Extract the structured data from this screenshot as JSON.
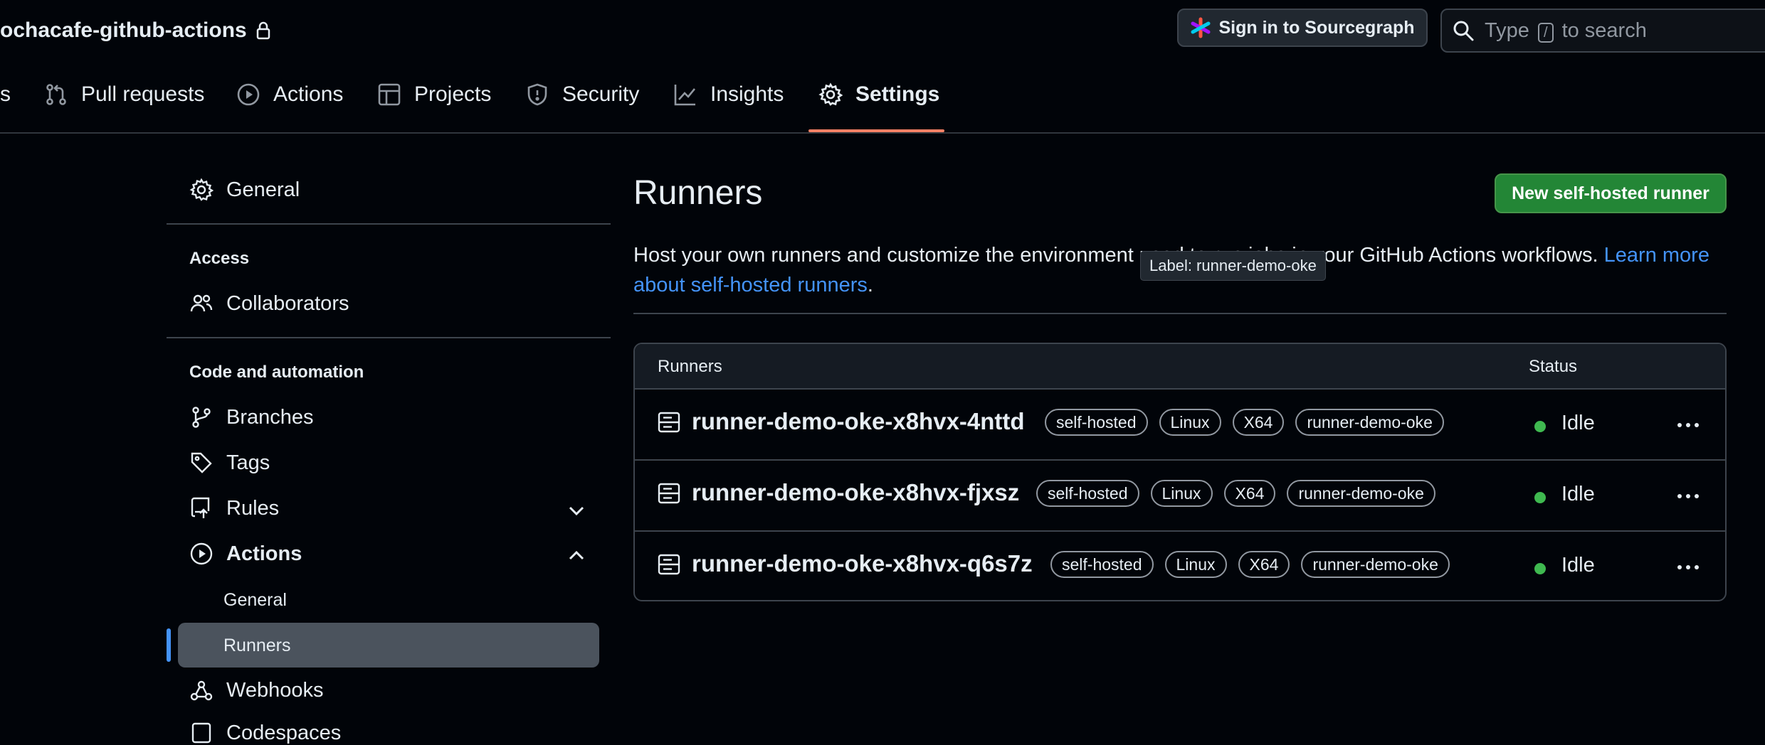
{
  "header": {
    "repo_title": "ochacafe-github-actions",
    "sourcegraph_button": "Sign in to Sourcegraph",
    "search": {
      "prefix": "Type",
      "key": "/",
      "suffix": "to search"
    }
  },
  "tabs": [
    {
      "label": "s"
    },
    {
      "label": "Pull requests"
    },
    {
      "label": "Actions"
    },
    {
      "label": "Projects"
    },
    {
      "label": "Security"
    },
    {
      "label": "Insights"
    },
    {
      "label": "Settings",
      "active": true
    }
  ],
  "sidebar": {
    "general": "General",
    "access_heading": "Access",
    "collaborators": "Collaborators",
    "code_heading": "Code and automation",
    "branches": "Branches",
    "tags": "Tags",
    "rules": "Rules",
    "actions": "Actions",
    "actions_general": "General",
    "actions_runners": "Runners",
    "webhooks": "Webhooks",
    "partial_next": "Codespaces"
  },
  "main": {
    "title": "Runners",
    "new_button": "New self-hosted runner",
    "desc_text_1": "Host your own runners and customize the environment used to run jobs in your GitHub Actions workflows.",
    "desc_link": "Learn more about self-hosted runners",
    "desc_end": ".",
    "tooltip": "Label: runner-demo-oke"
  },
  "table": {
    "col_runners": "Runners",
    "col_status": "Status",
    "rows": [
      {
        "name": "runner-demo-oke-x8hvx-4nttd",
        "labels": [
          "self-hosted",
          "Linux",
          "X64",
          "runner-demo-oke"
        ],
        "status": "Idle"
      },
      {
        "name": "runner-demo-oke-x8hvx-fjxsz",
        "labels": [
          "self-hosted",
          "Linux",
          "X64",
          "runner-demo-oke"
        ],
        "status": "Idle"
      },
      {
        "name": "runner-demo-oke-x8hvx-q6s7z",
        "labels": [
          "self-hosted",
          "Linux",
          "X64",
          "runner-demo-oke"
        ],
        "status": "Idle"
      }
    ]
  },
  "colors": {
    "background": "#010409",
    "accent_underline": "#f78166",
    "link": "#4493f8",
    "primary_button": "#238636",
    "status_idle": "#3fb950"
  }
}
